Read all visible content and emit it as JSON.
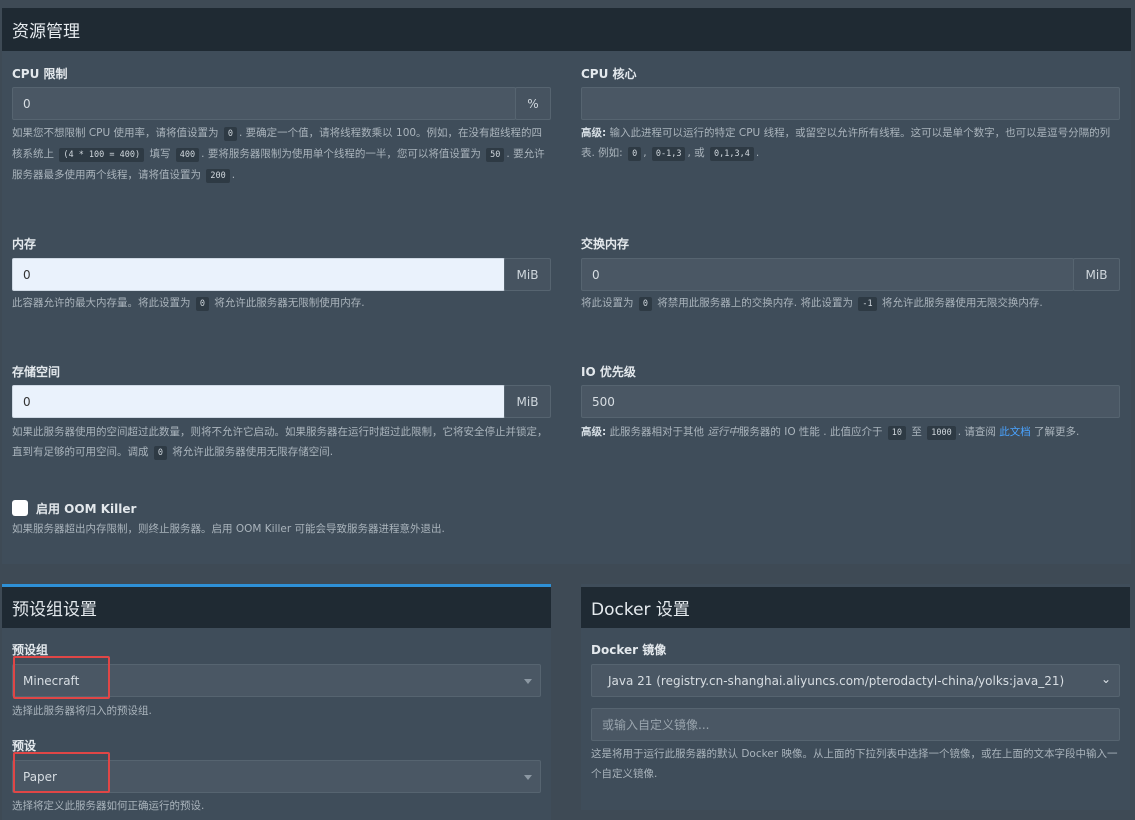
{
  "resource": {
    "title": "资源管理",
    "cpu_limit": {
      "label": "CPU 限制",
      "value": "0",
      "unit": "%",
      "help": [
        {
          "t": "如果您不想限制 CPU 使用率，请将值设置为 "
        },
        {
          "c": "0"
        },
        {
          "t": ". 要确定一个值，请将线程数乘以 100。例如，在没有超线程的四核系统上 "
        },
        {
          "c": "(4 * 100 = 400)"
        },
        {
          "t": " 填写 "
        },
        {
          "c": "400"
        },
        {
          "t": ". 要将服务器限制为使用单个线程的一半，您可以将值设置为 "
        },
        {
          "c": "50"
        },
        {
          "t": ". 要允许服务器最多使用两个线程，请将值设置为 "
        },
        {
          "c": "200"
        },
        {
          "t": "."
        }
      ]
    },
    "cpu_cores": {
      "label": "CPU 核心",
      "value": "",
      "help": [
        {
          "b": "高级:"
        },
        {
          "t": " 输入此进程可以运行的特定 CPU 线程，或留空以允许所有线程。这可以是单个数字，也可以是逗号分隔的列表. 例如: "
        },
        {
          "c": "0"
        },
        {
          "t": ", "
        },
        {
          "c": "0-1,3"
        },
        {
          "t": ", 或 "
        },
        {
          "c": "0,1,3,4"
        },
        {
          "t": "."
        }
      ]
    },
    "memory": {
      "label": "内存",
      "value": "0",
      "unit": "MiB",
      "help": [
        {
          "t": "此容器允许的最大内存量。将此设置为 "
        },
        {
          "c": "0"
        },
        {
          "t": " 将允许此服务器无限制使用内存."
        }
      ]
    },
    "swap": {
      "label": "交换内存",
      "value": "0",
      "unit": "MiB",
      "help": [
        {
          "t": "将此设置为 "
        },
        {
          "c": "0"
        },
        {
          "t": " 将禁用此服务器上的交换内存. 将此设置为 "
        },
        {
          "c": "-1"
        },
        {
          "t": " 将允许此服务器使用无限交换内存."
        }
      ]
    },
    "disk": {
      "label": "存储空间",
      "value": "0",
      "unit": "MiB",
      "help": [
        {
          "t": "如果此服务器使用的空间超过此数量，则将不允许它启动。如果服务器在运行时超过此限制，它将安全停止并锁定，直到有足够的可用空间。调成 "
        },
        {
          "c": "0"
        },
        {
          "t": " 将允许此服务器使用无限存储空间."
        }
      ]
    },
    "io": {
      "label": "IO 优先级",
      "value": "500",
      "help": [
        {
          "b": "高级:"
        },
        {
          "t": " 此服务器相对于其他 "
        },
        {
          "i": "运行中"
        },
        {
          "t": "服务器的 IO 性能 . 此值应介于 "
        },
        {
          "c": "10"
        },
        {
          "t": " 至 "
        },
        {
          "c": "1000"
        },
        {
          "t": ". 请查阅 "
        },
        {
          "a": "此文档"
        },
        {
          "t": " 了解更多."
        }
      ]
    },
    "oom": {
      "label": "启用 OOM Killer",
      "help": "如果服务器超出内存限制，则终止服务器。启用 OOM Killer 可能会导致服务器进程意外退出."
    }
  },
  "preset": {
    "title": "预设组设置",
    "group_label": "预设组",
    "group_value": "Minecraft",
    "group_help": "选择此服务器将归入的预设组.",
    "preset_label": "预设",
    "preset_value": "Paper",
    "preset_help": "选择将定义此服务器如何正确运行的预设."
  },
  "docker": {
    "title": "Docker 设置",
    "image_label": "Docker 镜像",
    "image_value": "Java 21 (registry.cn-shanghai.aliyuncs.com/pterodactyl-china/yolks:java_21)",
    "custom_placeholder": "或输入自定义镜像...",
    "help": "这是将用于运行此服务器的默认 Docker 映像。从上面的下拉列表中选择一个镜像，或在上面的文本字段中输入一个自定义镜像."
  },
  "colors": {
    "header": "#1f2a33",
    "panel": "#3f4d5a",
    "accent": "#2e90d6",
    "highlight_border": "#e04646",
    "link": "#4aa3ff"
  }
}
